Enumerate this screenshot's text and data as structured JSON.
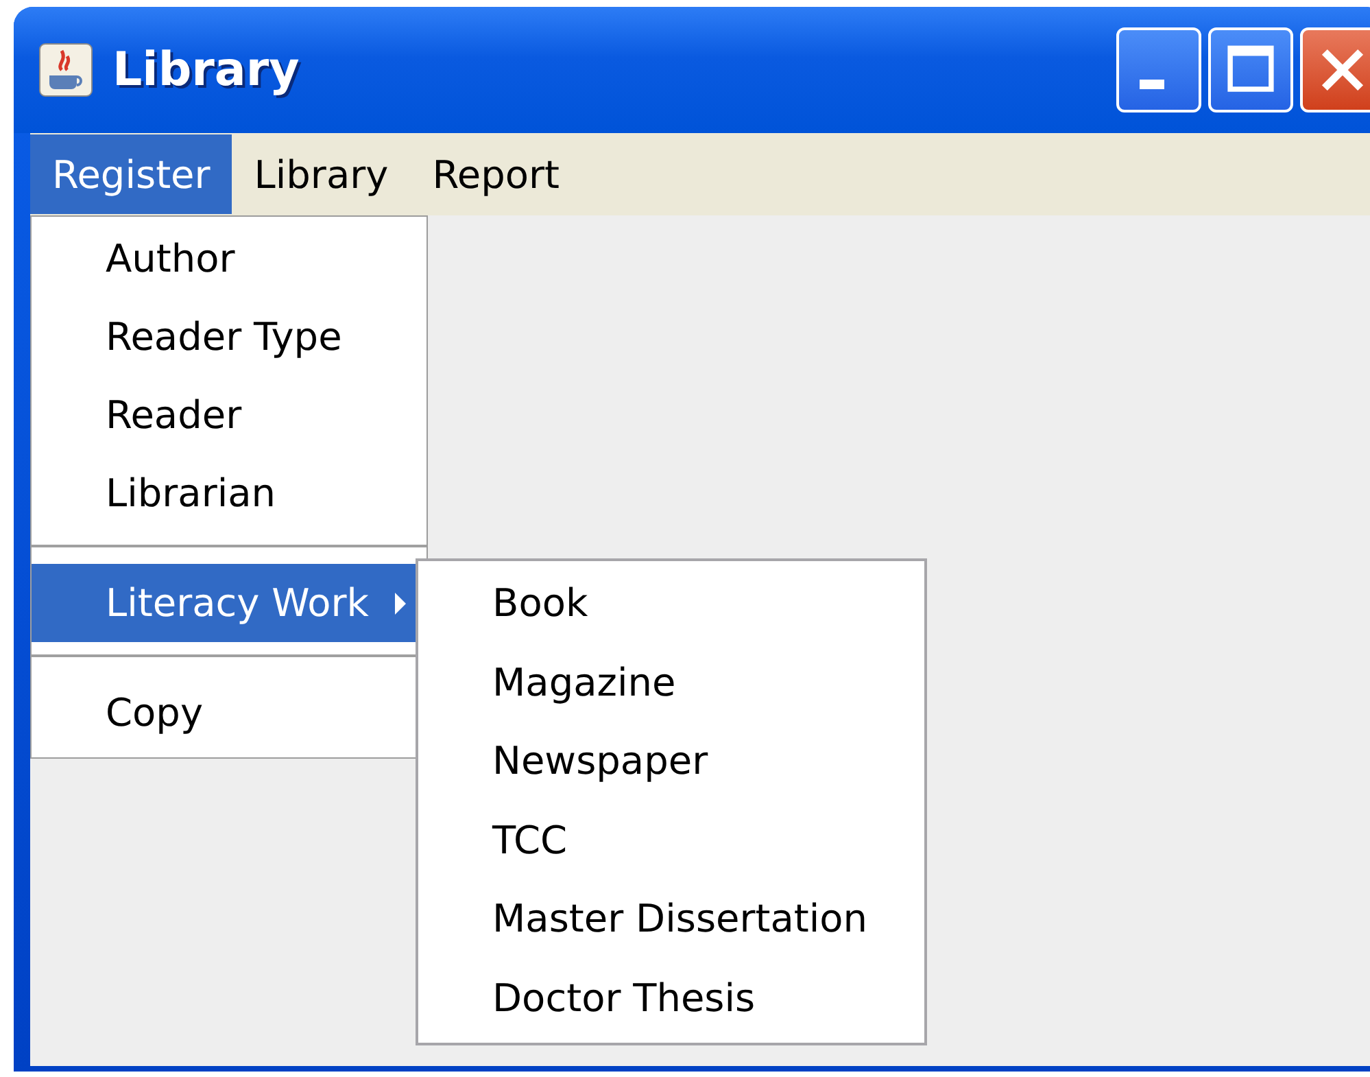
{
  "window": {
    "title": "Library"
  },
  "menu_bar": [
    {
      "label": "Register",
      "selected": true
    },
    {
      "label": "Library",
      "selected": false
    },
    {
      "label": "Report",
      "selected": false
    }
  ],
  "dropdown": [
    {
      "kind": "item",
      "label": "Author",
      "selected": false
    },
    {
      "kind": "item",
      "label": "Reader Type",
      "selected": false
    },
    {
      "kind": "item",
      "label": "Reader",
      "selected": false
    },
    {
      "kind": "item",
      "label": "Librarian",
      "selected": false
    },
    {
      "kind": "separator"
    },
    {
      "kind": "submenu",
      "label": "Literacy Work",
      "selected": true
    },
    {
      "kind": "separator"
    },
    {
      "kind": "item",
      "label": "Copy",
      "selected": false
    }
  ],
  "submenu": [
    {
      "label": "Book",
      "selected": false
    },
    {
      "label": "Magazine",
      "selected": false
    },
    {
      "label": "Newspaper",
      "selected": false
    },
    {
      "label": "TCC",
      "selected": false
    },
    {
      "label": "Master Dissertation",
      "selected": false
    },
    {
      "label": "Doctor Thesis",
      "selected": false
    }
  ]
}
